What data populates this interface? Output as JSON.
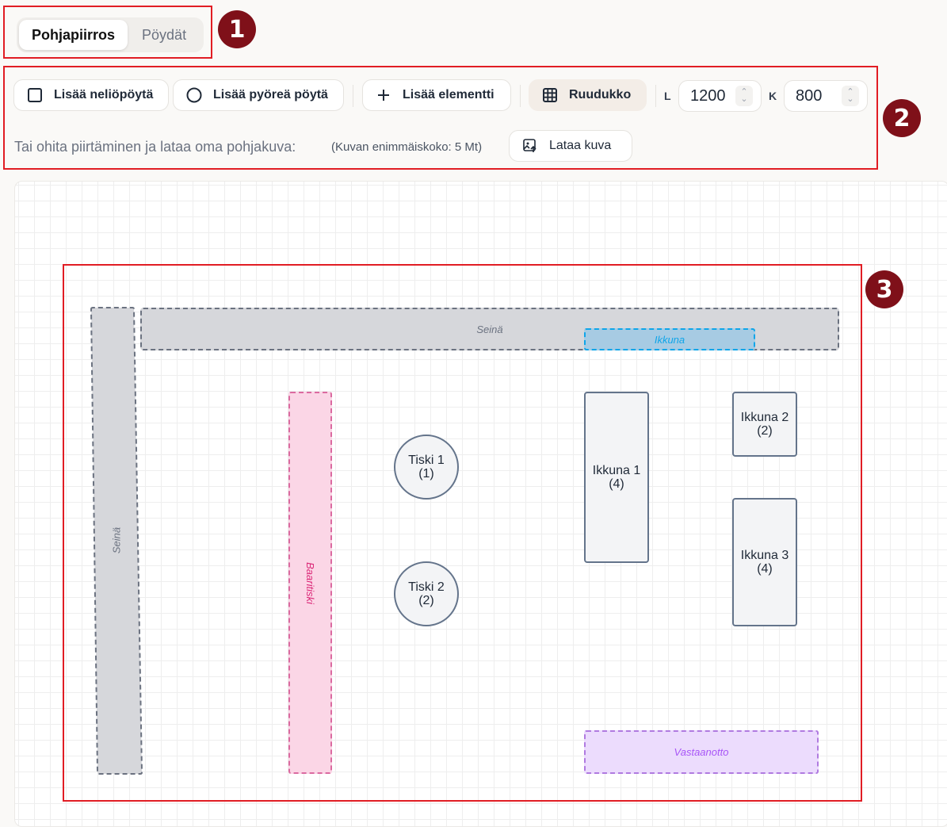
{
  "markers": [
    "1",
    "2",
    "3"
  ],
  "tabs": {
    "floorplan": "Pohjapiirros",
    "tables": "Pöydät"
  },
  "toolbar": {
    "add_square": "Lisää neliöpöytä",
    "add_round": "Lisää pyöreä pöytä",
    "add_element": "Lisää elementti",
    "grid": "Ruudukko",
    "width_label": "L",
    "width_value": "1200",
    "height_label": "K",
    "height_value": "800",
    "skip_text": "Tai ohita piirtäminen ja lataa oma pohjakuva:",
    "size_note": "(Kuvan enimmäiskoko: 5 Mt)",
    "upload": "Lataa kuva"
  },
  "elements": {
    "wall_top": "Seinä",
    "wall_left": "Seinä",
    "window": "Ikkuna",
    "bar": "Baaritiski",
    "reception": "Vastaanotto"
  },
  "tables": {
    "tiski1": {
      "name": "Tiski 1",
      "seats": "(1)"
    },
    "tiski2": {
      "name": "Tiski 2",
      "seats": "(2)"
    },
    "ikkuna1": {
      "name": "Ikkuna 1",
      "seats": "(4)"
    },
    "ikkuna2": {
      "name": "Ikkuna 2",
      "seats": "(2)"
    },
    "ikkuna3": {
      "name": "Ikkuna 3",
      "seats": "(4)"
    }
  },
  "colors": {
    "annotation_red": "#e11d24",
    "marker": "#7f1019",
    "bar": "#db2777",
    "window": "#0ea5e9",
    "reception": "#a855f7"
  }
}
